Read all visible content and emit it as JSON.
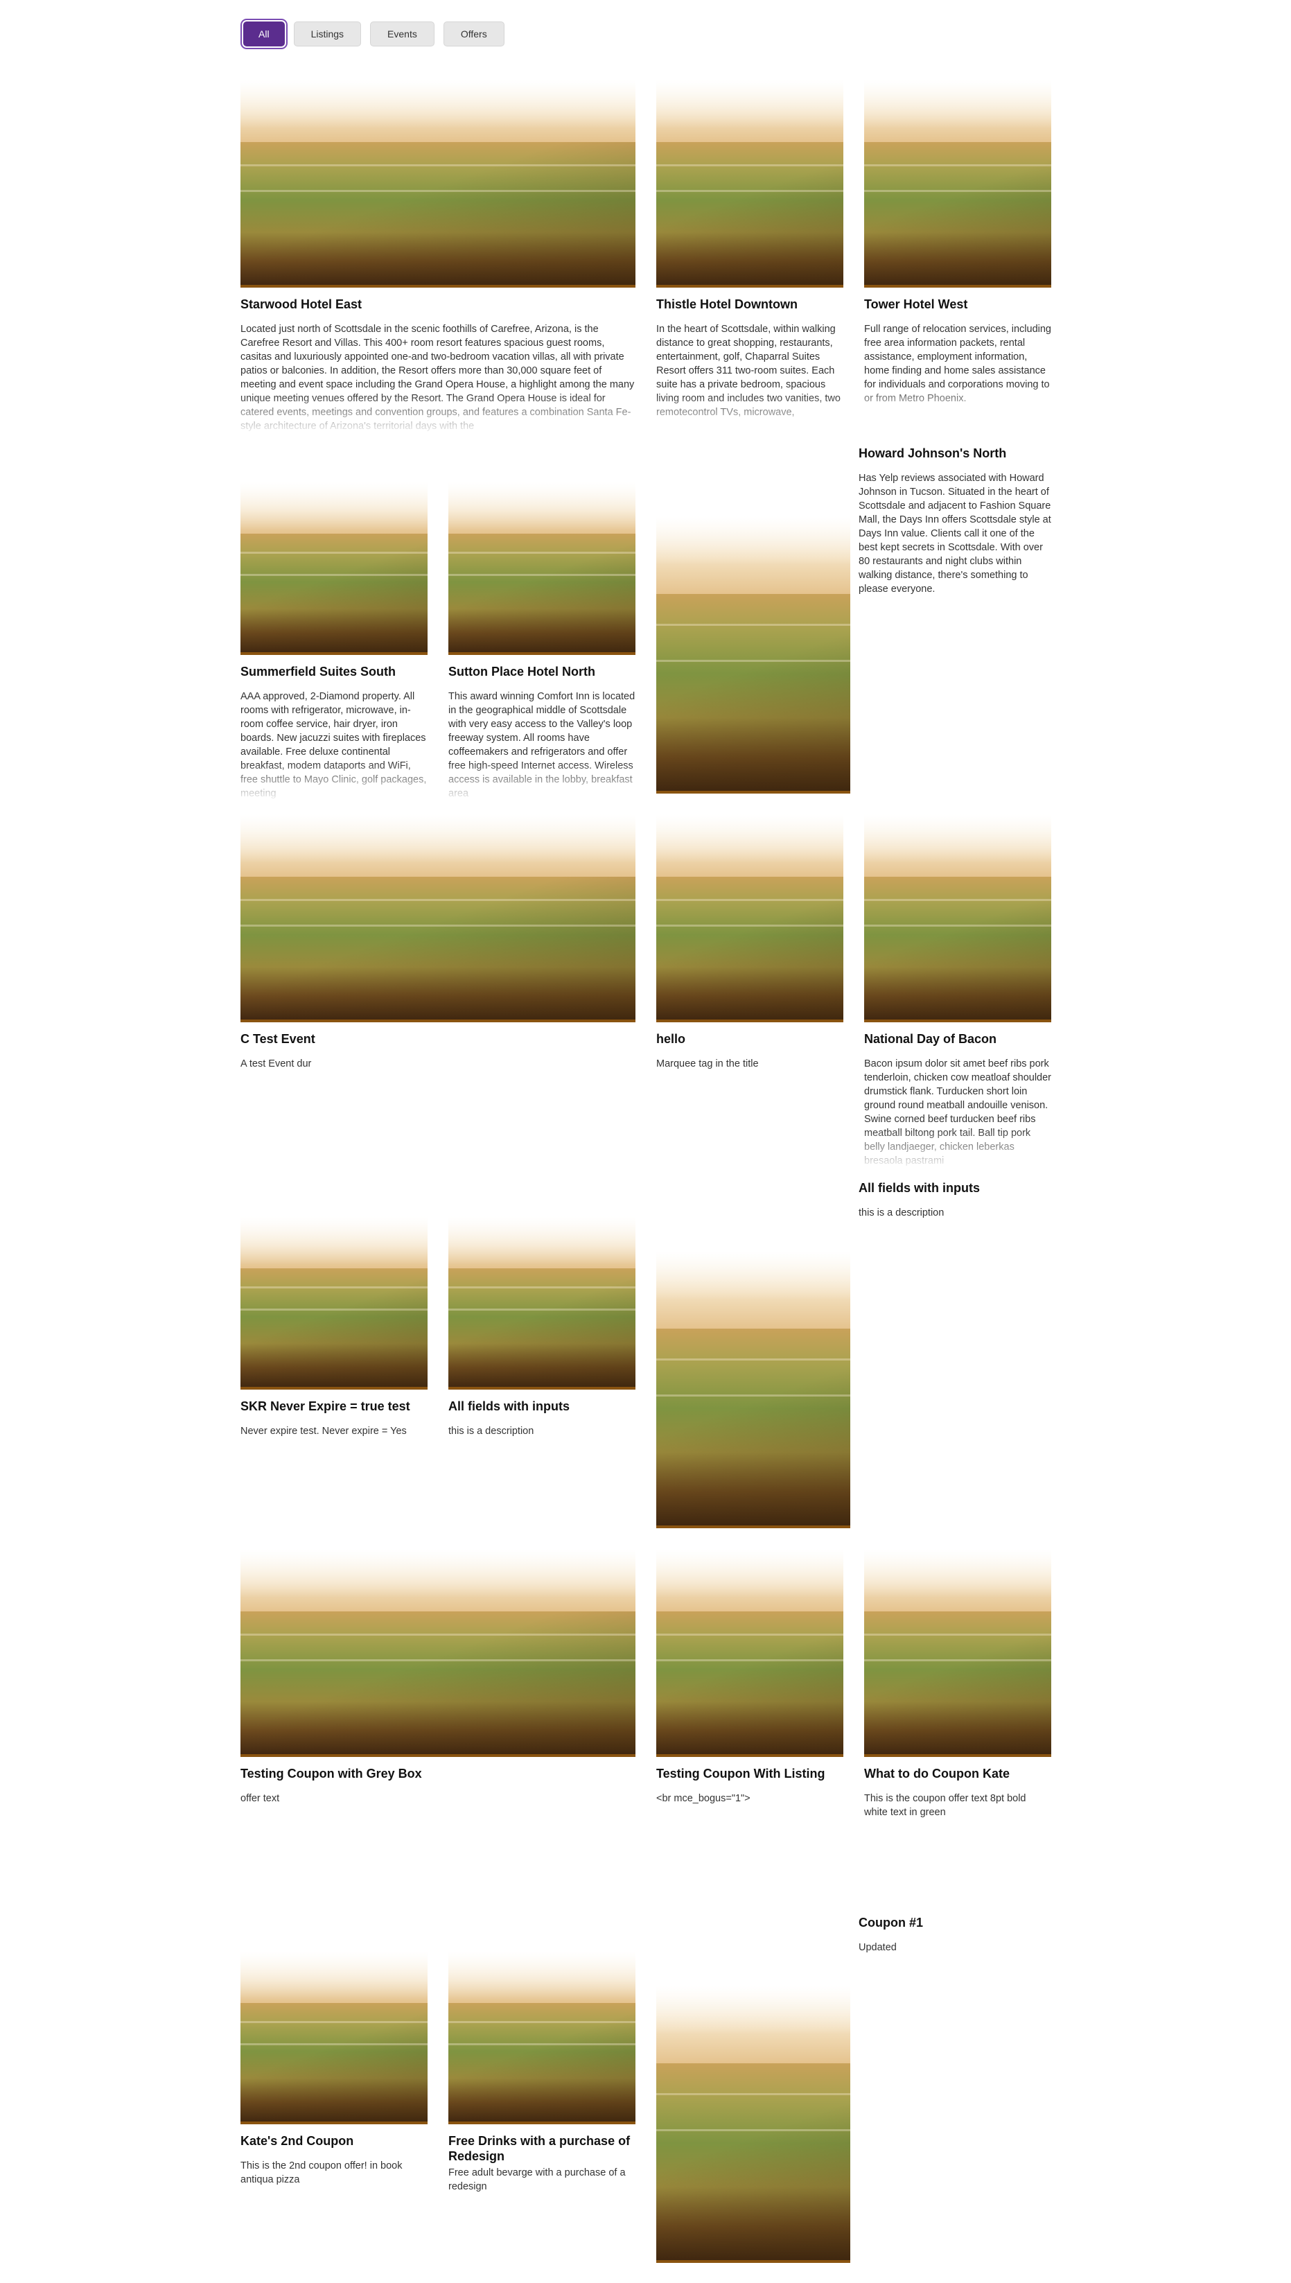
{
  "filters": [
    {
      "label": "All",
      "active": true
    },
    {
      "label": "Listings",
      "active": false
    },
    {
      "label": "Events",
      "active": false
    },
    {
      "label": "Offers",
      "active": false
    }
  ],
  "cards": [
    {
      "title": "Starwood Hotel East",
      "description": "Located just north of Scottsdale in the scenic foothills of Carefree, Arizona, is the Carefree Resort and Villas. This 400+ room resort features spacious guest rooms, casitas and luxuriously appointed one-and two-bedroom vacation villas, all with private patios or balconies. In addition, the Resort offers more than 30,000 square feet of meeting and event space including the Grand Opera House, a highlight among the many unique meeting venues offered by the Resort. The Grand Opera House is ideal for catered events, meetings and convention groups, and features a combination Santa Fe-style architecture of Arizona's territorial days with the"
    },
    {
      "title": "Thistle Hotel Downtown",
      "description": "In the heart of Scottsdale, within walking distance to great shopping, restaurants, entertainment, golf, Chaparral Suites Resort offers 311 two-room suites. Each suite has a private bedroom, spacious living room and includes two vanities, two remotecontrol TVs, microwave,"
    },
    {
      "title": "Tower Hotel West",
      "description": "Full range of relocation services, including free area information packets, rental assistance, employment information, home finding and home sales assistance for individuals and corporations moving to or from Metro Phoenix."
    },
    {
      "title": "Summerfield Suites South",
      "description": "AAA approved, 2-Diamond property. All rooms with refrigerator, microwave, in-room coffee service, hair dryer, iron boards. New jacuzzi suites with fireplaces available. Free deluxe continental breakfast, modem dataports and WiFi, free shuttle to Mayo Clinic, golf packages, meeting"
    },
    {
      "title": "Sutton Place Hotel North",
      "description": "This award winning Comfort Inn is located in the geographical middle of Scottsdale with very easy access to the Valley's loop freeway system. All rooms have coffeemakers and refrigerators and offer free high-speed Internet access. Wireless access is available in the lobby, breakfast area"
    },
    {
      "title": "Howard Johnson's North",
      "description": "Has Yelp reviews associated with Howard Johnson in Tucson. Situated in the heart of Scottsdale and adjacent to Fashion Square Mall, the Days Inn offers Scottsdale style at Days Inn value. Clients call it one of the best kept secrets in Scottsdale. With over 80 restaurants and night clubs within walking distance, there's something to please everyone."
    },
    {
      "title": "C Test Event",
      "description": "A test Event dur"
    },
    {
      "title": "hello",
      "description": "Marquee tag in the title"
    },
    {
      "title": "National Day of Bacon",
      "description": "Bacon ipsum dolor sit amet beef ribs pork tenderloin, chicken cow meatloaf shoulder drumstick flank. Turducken short loin ground round meatball andouille venison. Swine corned beef turducken beef ribs meatball biltong pork tail. Ball tip pork belly landjaeger, chicken leberkas bresaola pastrami"
    },
    {
      "title": "All fields with inputs",
      "description": "this is a description"
    },
    {
      "title": "SKR Never Expire = true test",
      "description": "Never expire test. Never expire = Yes"
    },
    {
      "title": "All fields with inputs",
      "description": "this is a description"
    },
    {
      "title": "Testing Coupon with Grey Box",
      "description": "offer text"
    },
    {
      "title": "Testing Coupon With Listing",
      "description": "<br mce_bogus=\"1\">"
    },
    {
      "title": "What to do Coupon Kate",
      "description": "This is the coupon offer text 8pt bold white text in green"
    },
    {
      "title": "Coupon #1",
      "description": "Updated"
    },
    {
      "title": "Kate's 2nd Coupon",
      "description": "This is the 2nd coupon offer! in book antiqua pizza"
    },
    {
      "title": "Free Drinks with a purchase of Redesign",
      "description": "Free adult bevarge with a purchase of a redesign"
    },
    {
      "title": "",
      "description": ""
    }
  ],
  "colors": {
    "accent": "#5b2d8e",
    "button_bg": "#e7e7e7"
  }
}
